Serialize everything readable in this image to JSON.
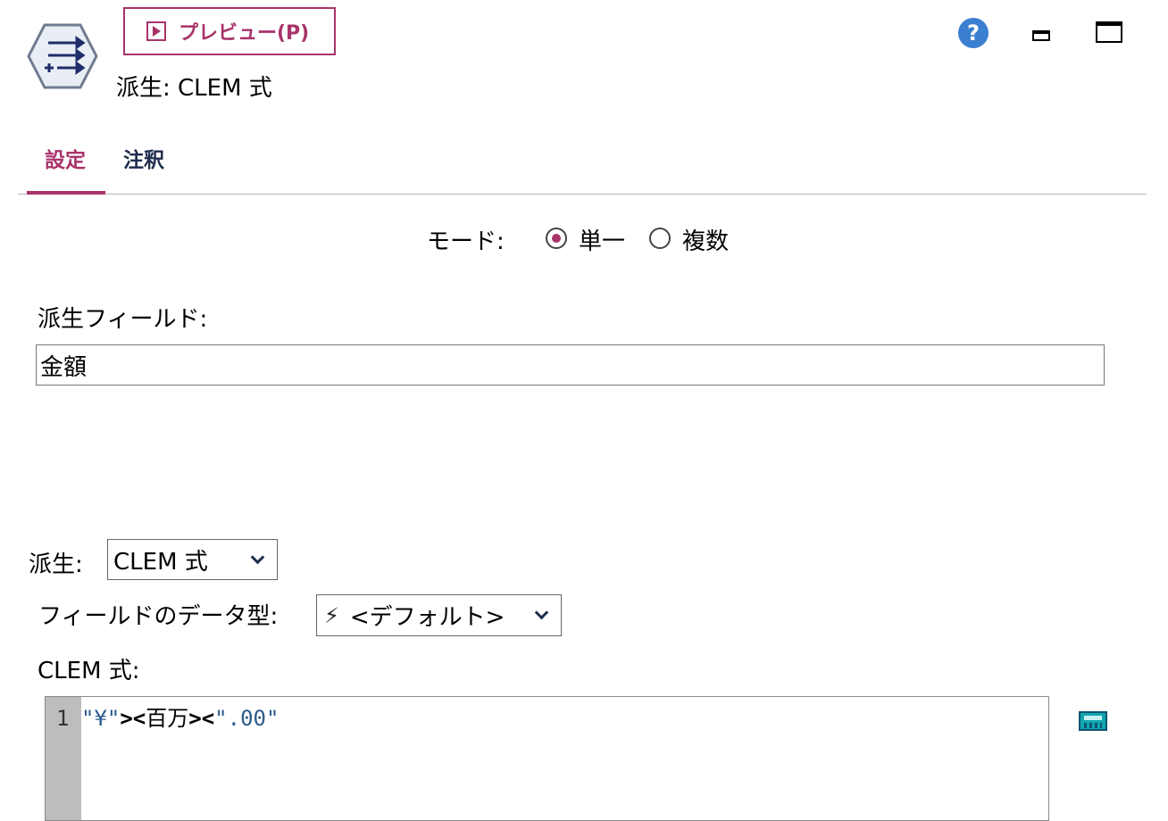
{
  "header": {
    "preview_label": "プレビュー(P)",
    "node_title": "派生: CLEM 式",
    "help_glyph": "?"
  },
  "tabs": [
    {
      "label": "設定",
      "active": true
    },
    {
      "label": "注釈",
      "active": false
    }
  ],
  "mode": {
    "label": "モード:",
    "options": [
      "単一",
      "複数"
    ],
    "selected": "単一"
  },
  "derive_field": {
    "label": "派生フィールド:",
    "value": "金額"
  },
  "derive_as": {
    "label": "派生:",
    "value": "CLEM 式"
  },
  "field_type": {
    "label": "フィールドのデータ型:",
    "value": "<デフォルト>",
    "icon": "lightning-bolt-icon"
  },
  "clem": {
    "label": "CLEM 式:",
    "line_number": "1",
    "tokens": [
      "\"¥\"",
      "><",
      "百万",
      "><",
      "\".00\""
    ]
  },
  "colors": {
    "accent": "#a8336a",
    "tab_inactive": "#1f2d4d",
    "string_token": "#2c5b8e",
    "help_icon": "#3b7fd0"
  }
}
